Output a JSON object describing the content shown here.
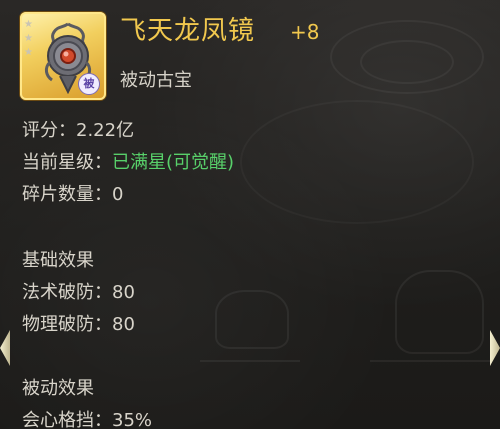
{
  "item": {
    "name": "飞天龙凤镜",
    "level": "+8",
    "type": "被动古宝",
    "badge": "被",
    "stars": [
      "★",
      "★",
      "★"
    ]
  },
  "stats": {
    "score_label": "评分：",
    "score_value": "2.22亿",
    "star_label": "当前星级：",
    "star_value": "已满星(可觉醒)",
    "fragments_label": "碎片数量：",
    "fragments_value": "0"
  },
  "basic_effects": {
    "title": "基础效果",
    "items": [
      {
        "label": "法术破防：",
        "value": "80"
      },
      {
        "label": "物理破防：",
        "value": "80"
      }
    ]
  },
  "passive_effects": {
    "title": "被动效果",
    "items": [
      {
        "label": "会心格挡：",
        "value": "35%"
      }
    ]
  },
  "colors": {
    "name": "#f1c84e",
    "highlight_green": "#58d06a",
    "text": "#d8d4ca"
  },
  "icons": {
    "item_icon": "dragon-phoenix-mirror-icon",
    "nav_left": "arrow-left-icon",
    "nav_right": "arrow-right-icon"
  }
}
